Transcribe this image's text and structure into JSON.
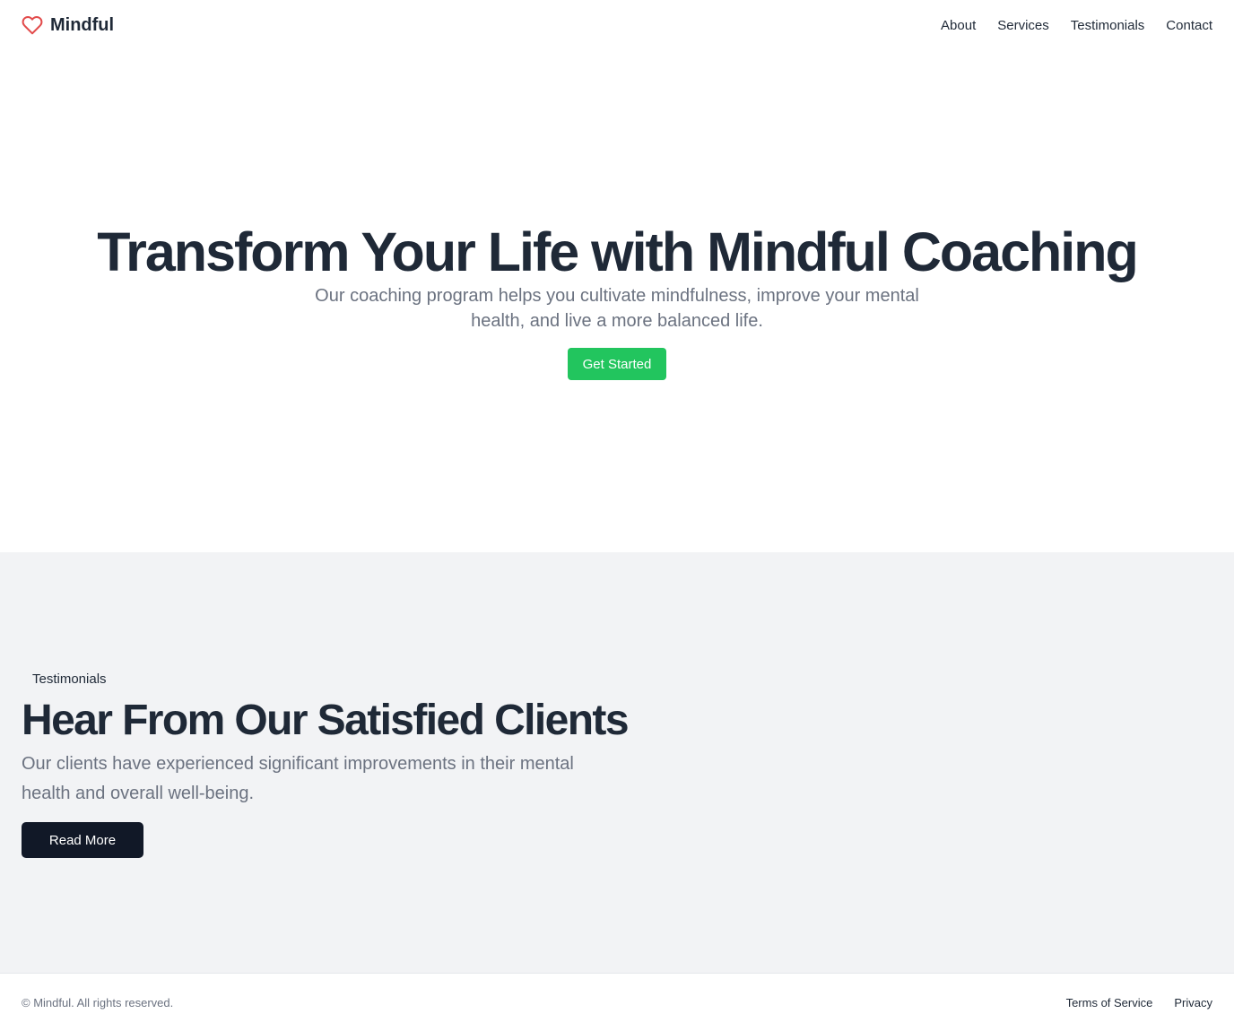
{
  "brand": {
    "name": "Mindful",
    "icon": "heart-icon",
    "icon_color": "#e24b4b"
  },
  "nav": {
    "items": [
      {
        "label": "About"
      },
      {
        "label": "Services"
      },
      {
        "label": "Testimonials"
      },
      {
        "label": "Contact"
      }
    ]
  },
  "hero": {
    "title": "Transform Your Life with Mindful Coaching",
    "subtitle": "Our coaching program helps you cultivate mindfulness, improve your mental health, and live a more balanced life.",
    "cta_label": "Get Started",
    "cta_color": "#22c55e"
  },
  "testimonials": {
    "eyebrow": "Testimonials",
    "title": "Hear From Our Satisfied Clients",
    "subtitle": "Our clients have experienced significant improvements in their mental health and overall well-being.",
    "cta_label": "Read More",
    "background": "#f2f3f5",
    "cta_color": "#111827"
  },
  "footer": {
    "copyright": "© Mindful. All rights reserved.",
    "links": [
      {
        "label": "Terms of Service"
      },
      {
        "label": "Privacy"
      }
    ]
  }
}
